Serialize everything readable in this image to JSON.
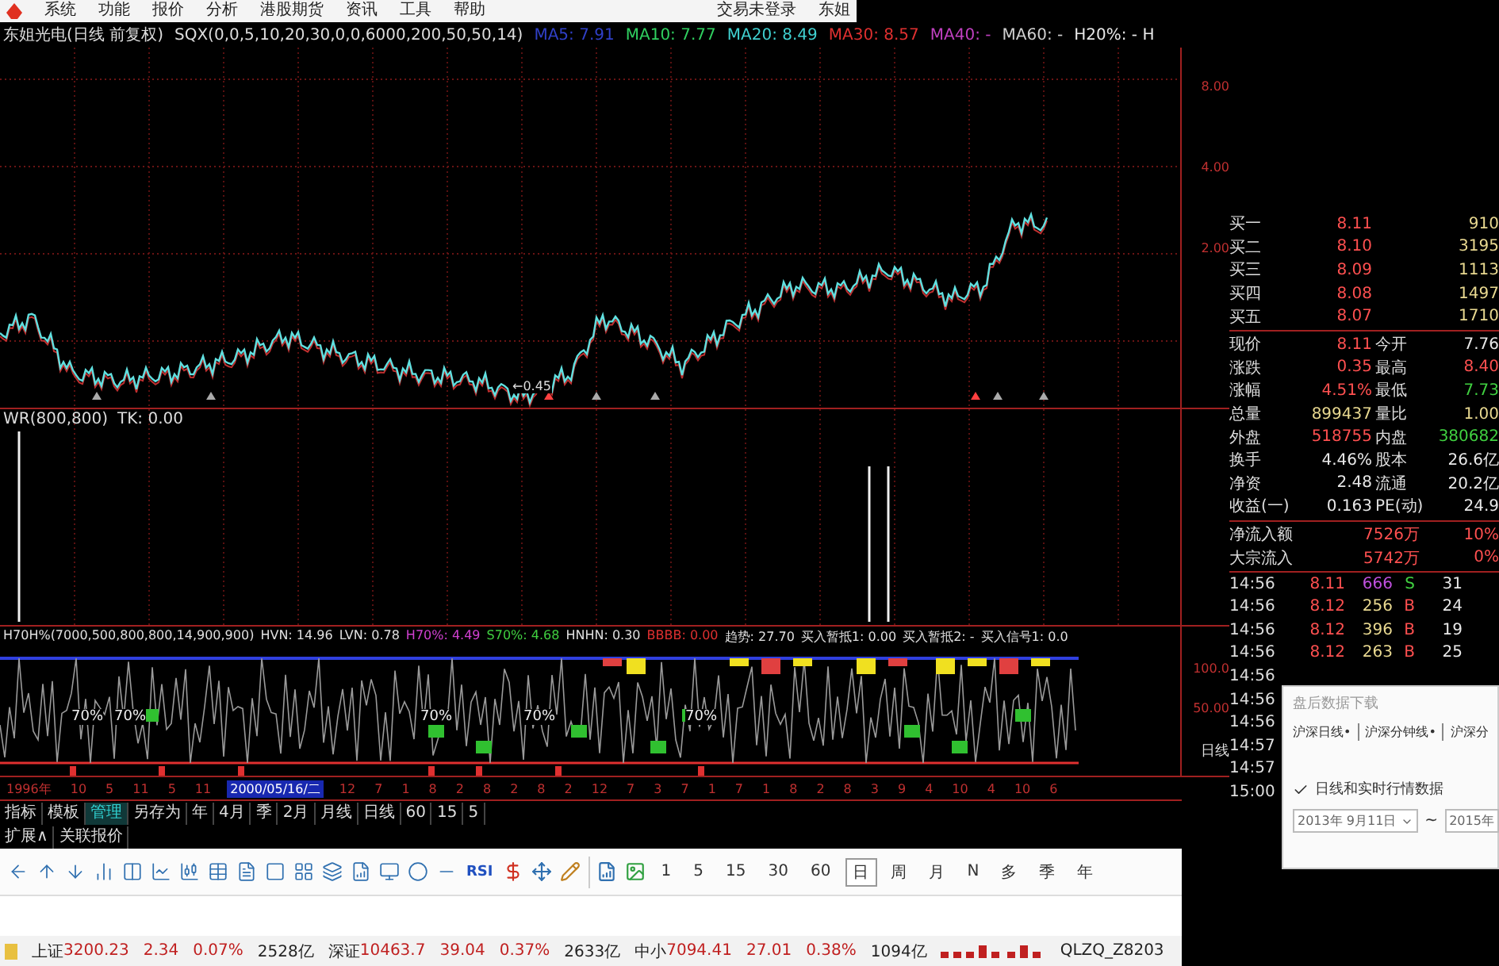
{
  "menu": {
    "items": [
      "系统",
      "功能",
      "报价",
      "分析",
      "港股期货",
      "资讯",
      "工具",
      "帮助"
    ],
    "status": "交易未登录",
    "user": "东姐"
  },
  "header": {
    "title": "东姐光电(日线 前复权)",
    "formula": "SQX(0,0,5,10,20,30,0,0,6000,200,50,50,14)",
    "indicators": [
      {
        "label": "MA5: 7.91",
        "color": "#3040c8"
      },
      {
        "label": "MA10: 7.77",
        "color": "#30d060"
      },
      {
        "label": "MA20: 8.49",
        "color": "#40d0d0"
      },
      {
        "label": "MA30: 8.57",
        "color": "#e03030"
      },
      {
        "label": "MA40: -",
        "color": "#c040c0"
      },
      {
        "label": "MA60: -",
        "color": "#d0d0d0"
      },
      {
        "label": "H20%: - H",
        "color": "#e8e8e8"
      }
    ]
  },
  "price_panel": {
    "axis_labels": [
      "8.00",
      "4.00",
      "2.00"
    ],
    "low_label": "←0.45"
  },
  "wr_panel": {
    "title": "WR(800,800)",
    "reading": "TK: 0.00"
  },
  "h70_panel": {
    "parts": [
      {
        "text": "H70H%(7000,500,800,800,14,900,900)",
        "color": "#e0e0e0"
      },
      {
        "text": "HVN: 14.96",
        "color": "#e0e0e0"
      },
      {
        "text": "LVN: 0.78",
        "color": "#e0e0e0"
      },
      {
        "text": "H70%: 4.49",
        "color": "#d040d0"
      },
      {
        "text": "S70%: 4.68",
        "color": "#40d040"
      },
      {
        "text": "HNHN: 0.30",
        "color": "#e0e0e0"
      },
      {
        "text": "BBBB: 0.00",
        "color": "#e03030"
      },
      {
        "text": "趋势: 27.70",
        "color": "#e0e0e0"
      },
      {
        "text": "买入暂抵1: 0.00",
        "color": "#e0e0e0"
      },
      {
        "text": "买入暂抵2: -",
        "color": "#e0e0e0"
      },
      {
        "text": "买入信号1: 0.0",
        "color": "#e0e0e0"
      }
    ],
    "axis_labels": [
      "100.0",
      "50.00"
    ],
    "period_label": "日线",
    "annotations": [
      "70%",
      "70%",
      "70%",
      "70%",
      "70%"
    ]
  },
  "date_axis": [
    {
      "text": "1996年",
      "selected": false
    },
    {
      "text": "10",
      "selected": false
    },
    {
      "text": "5",
      "selected": false
    },
    {
      "text": "11",
      "selected": false
    },
    {
      "text": "5",
      "selected": false
    },
    {
      "text": "11",
      "selected": false
    },
    {
      "text": "2000/05/16/二",
      "selected": true
    },
    {
      "text": "12",
      "selected": false
    },
    {
      "text": "7",
      "selected": false
    },
    {
      "text": "1",
      "selected": false
    },
    {
      "text": "8",
      "selected": false
    },
    {
      "text": "2",
      "selected": false
    },
    {
      "text": "8",
      "selected": false
    },
    {
      "text": "2",
      "selected": false
    },
    {
      "text": "8",
      "selected": false
    },
    {
      "text": "2",
      "selected": false
    },
    {
      "text": "12",
      "selected": false
    },
    {
      "text": "7",
      "selected": false
    },
    {
      "text": "3",
      "selected": false
    },
    {
      "text": "7",
      "selected": false
    },
    {
      "text": "1",
      "selected": false
    },
    {
      "text": "7",
      "selected": false
    },
    {
      "text": "1",
      "selected": false
    },
    {
      "text": "8",
      "selected": false
    },
    {
      "text": "2",
      "selected": false
    },
    {
      "text": "8",
      "selected": false
    },
    {
      "text": "3",
      "selected": false
    },
    {
      "text": "9",
      "selected": false
    },
    {
      "text": "4",
      "selected": false
    },
    {
      "text": "10",
      "selected": false
    },
    {
      "text": "4",
      "selected": false
    },
    {
      "text": "10",
      "selected": false
    },
    {
      "text": "6",
      "selected": false
    }
  ],
  "period_bar": [
    {
      "label": "指标",
      "selected": false
    },
    {
      "label": "模板",
      "selected": false
    },
    {
      "label": "管理",
      "selected": true
    },
    {
      "label": "另存为",
      "selected": false
    },
    {
      "label": "年",
      "selected": false
    },
    {
      "label": "4月",
      "selected": false
    },
    {
      "label": "季",
      "selected": false
    },
    {
      "label": "2月",
      "selected": false
    },
    {
      "label": "月线",
      "selected": false
    },
    {
      "label": "日线",
      "selected": false
    },
    {
      "label": "60",
      "selected": false
    },
    {
      "label": "15",
      "selected": false
    },
    {
      "label": "5",
      "selected": false
    }
  ],
  "ext_bar": [
    "扩展∧",
    "关联报价"
  ],
  "toolbar": {
    "indicator_button": "RSI",
    "periods": [
      {
        "label": "1",
        "selected": false
      },
      {
        "label": "5",
        "selected": false
      },
      {
        "label": "15",
        "selected": false
      },
      {
        "label": "30",
        "selected": false
      },
      {
        "label": "60",
        "selected": false
      },
      {
        "label": "日",
        "selected": true
      },
      {
        "label": "周",
        "selected": false
      },
      {
        "label": "月",
        "selected": false
      },
      {
        "label": "N",
        "selected": false
      },
      {
        "label": "多",
        "selected": false
      },
      {
        "label": "季",
        "selected": false
      },
      {
        "label": "年",
        "selected": false
      }
    ]
  },
  "status_bar": {
    "indices": [
      {
        "name": "上证",
        "value": "3200.23",
        "change": "2.34",
        "percent": "0.07%",
        "amount": "2528亿"
      },
      {
        "name": "深证",
        "value": "10463.7",
        "change": "39.04",
        "percent": "0.37%",
        "amount": "2633亿"
      },
      {
        "name": "中小",
        "value": "7094.41",
        "change": "27.01",
        "percent": "0.38%",
        "amount": "1094亿"
      }
    ],
    "account": "QLZQ_Z8203"
  },
  "quote": {
    "bids": [
      {
        "label": "买一",
        "price": "8.11",
        "volume": "910"
      },
      {
        "label": "买二",
        "price": "8.10",
        "volume": "3195"
      },
      {
        "label": "买三",
        "price": "8.09",
        "volume": "1113"
      },
      {
        "label": "买四",
        "price": "8.08",
        "volume": "1497"
      },
      {
        "label": "买五",
        "price": "8.07",
        "volume": "1710"
      }
    ],
    "stats": [
      {
        "cells": [
          {
            "label": "现价",
            "value": "8.11",
            "color": "#ff5050"
          },
          {
            "label": "今开",
            "value": "7.76",
            "color": "#e8e8e8"
          }
        ]
      },
      {
        "cells": [
          {
            "label": "涨跌",
            "value": "0.35",
            "color": "#ff5050"
          },
          {
            "label": "最高",
            "value": "8.40",
            "color": "#ff5050"
          }
        ]
      },
      {
        "cells": [
          {
            "label": "涨幅",
            "value": "4.51%",
            "color": "#ff5050"
          },
          {
            "label": "最低",
            "value": "7.73",
            "color": "#40d040"
          }
        ]
      },
      {
        "cells": [
          {
            "label": "总量",
            "value": "899437",
            "color": "#e8d890"
          },
          {
            "label": "量比",
            "value": "1.00",
            "color": "#e8d890"
          }
        ]
      },
      {
        "cells": [
          {
            "label": "外盘",
            "value": "518755",
            "color": "#ff5050"
          },
          {
            "label": "内盘",
            "value": "380682",
            "color": "#40d040"
          }
        ]
      },
      {
        "cells": [
          {
            "label": "换手",
            "value": "4.46%",
            "color": "#e8e8e8"
          },
          {
            "label": "股本",
            "value": "26.6亿",
            "color": "#e8e8e8"
          }
        ]
      },
      {
        "cells": [
          {
            "label": "净资",
            "value": "2.48",
            "color": "#e8e8e8"
          },
          {
            "label": "流通",
            "value": "20.2亿",
            "color": "#e8e8e8"
          }
        ]
      },
      {
        "cells": [
          {
            "label": "收益(一)",
            "value": "0.163",
            "color": "#e8e8e8"
          },
          {
            "label": "PE(动)",
            "value": "24.9",
            "color": "#e8e8e8"
          }
        ]
      }
    ],
    "flows": [
      {
        "label": "净流入额",
        "value": "7526万",
        "percent": "10%"
      },
      {
        "label": "大宗流入",
        "value": "5742万",
        "percent": "0%"
      }
    ],
    "ticks": [
      {
        "time": "14:56",
        "price": "8.11",
        "volume": "666",
        "side": "S",
        "kind": "sell",
        "extra": "31"
      },
      {
        "time": "14:56",
        "price": "8.12",
        "volume": "256",
        "side": "B",
        "kind": "buy",
        "extra": "24"
      },
      {
        "time": "14:56",
        "price": "8.12",
        "volume": "396",
        "side": "B",
        "kind": "buy",
        "extra": "19"
      },
      {
        "time": "14:56",
        "price": "8.12",
        "volume": "263",
        "side": "B",
        "kind": "buy",
        "extra": "25"
      },
      {
        "time": "14:56"
      },
      {
        "time": "14:56"
      },
      {
        "time": "14:56"
      },
      {
        "time": "14:57"
      },
      {
        "time": "14:57"
      },
      {
        "time": "15:00"
      }
    ]
  },
  "dialog": {
    "title": "盘后数据下载",
    "tabs": [
      "沪深日线•",
      "沪深分钟线•",
      "沪深分"
    ],
    "option": {
      "label": "日线和实时行情数据",
      "checked": true
    },
    "start_date": "2013年 9月11日",
    "separator": "~",
    "end_date": "2015年"
  }
}
